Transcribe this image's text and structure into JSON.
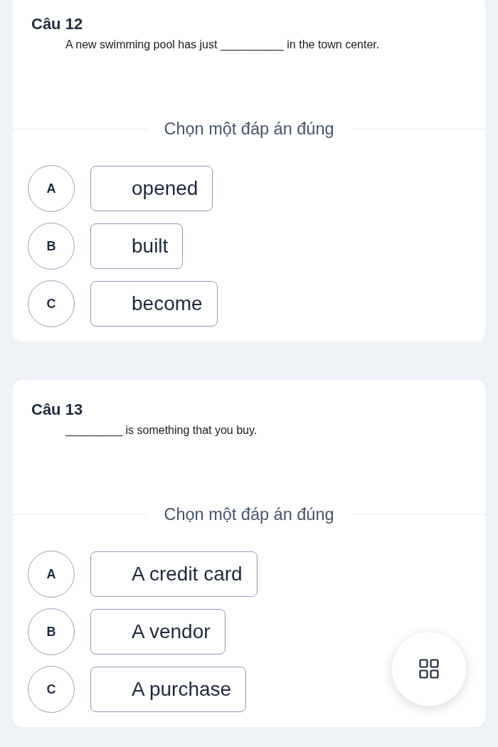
{
  "questions": [
    {
      "title": "Câu 12",
      "sentence": "A new swimming pool has just __________ in the town center.",
      "instruction": "Chọn một đáp án đúng",
      "options": [
        {
          "letter": "A",
          "text": "opened",
          "selected": false
        },
        {
          "letter": "B",
          "text": "built",
          "selected": false
        },
        {
          "letter": "C",
          "text": "become",
          "selected": false
        }
      ]
    },
    {
      "title": "Câu 13",
      "sentence": "_________ is something that you buy.",
      "instruction": "Chọn một đáp án đúng",
      "options": [
        {
          "letter": "A",
          "text": "A credit card",
          "selected": false
        },
        {
          "letter": "B",
          "text": "A vendor",
          "selected": false
        },
        {
          "letter": "C",
          "text": "A purchase",
          "selected": false
        }
      ]
    }
  ]
}
